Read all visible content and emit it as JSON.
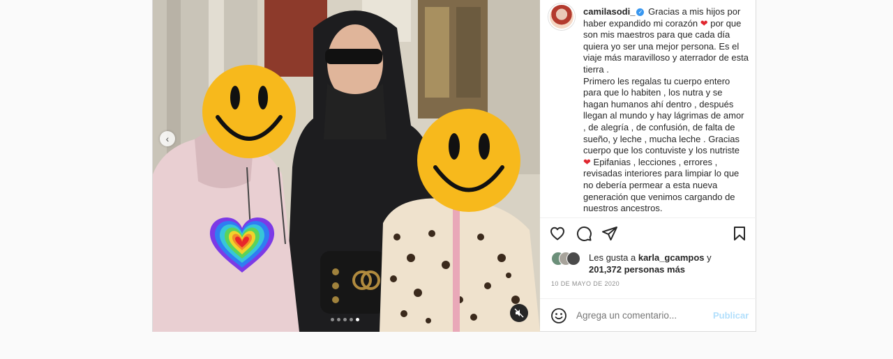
{
  "post": {
    "username": "camilasodi_",
    "caption_lines": [
      "Gracias a mis hijos por",
      "haber expandido mi corazón",
      "por que",
      "son mis maestros para que cada día",
      "quiera yo ser una mejor persona. Es el",
      "viaje más maravilloso y aterrador de esta",
      "tierra .",
      "Primero les regalas tu cuerpo entero",
      "para que lo habiten , los nutra y se",
      "hagan humanos ahí dentro , después",
      "llegan al mundo y hay lágrimas de amor",
      ", de alegría , de confusión, de falta de",
      "sueño, y leche , mucha leche . Gracias",
      "cuerpo que los contuviste y los nutriste",
      "Epifanias , lecciones , errores ,",
      "revisadas interiores para limpiar lo que",
      "no debería permear a esta nueva",
      "generación que venimos cargando de",
      "nuestros ancestros."
    ],
    "likes_prefix": "Les gusta a",
    "likes_user": "karla_gcampos",
    "likes_and": "y",
    "likes_count": "201,372 personas más",
    "date": "10 DE MAYO DE 2020",
    "comment_placeholder": "Agrega un comentario...",
    "publish_label": "Publicar",
    "carousel": {
      "slides": 5,
      "active_index": 4
    }
  },
  "icons": {
    "prev": "chevron-left-icon",
    "mute": "muted-speaker-icon",
    "like": "heart-outline-icon",
    "comment": "speech-bubble-icon",
    "share": "paper-plane-icon",
    "save": "bookmark-icon",
    "emoji": "smiley-icon"
  },
  "colors": {
    "link_blue": "#3897f0",
    "publish_disabled": "#b2dffc",
    "muted_text": "#8e8e8e",
    "heart_red": "#e0262f"
  }
}
